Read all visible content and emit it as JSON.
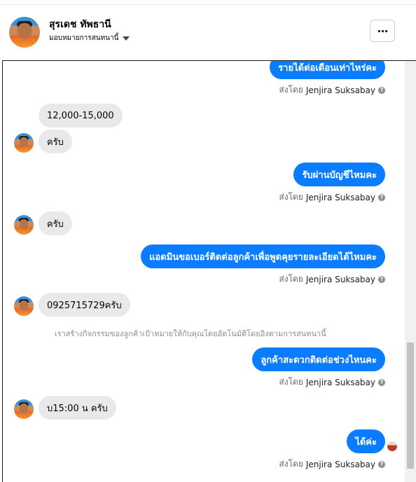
{
  "header": {
    "name": "สุรเดช ทัพธานี",
    "assign": "มอบหมายการสนทนานี้",
    "more_label": "···"
  },
  "icons": {
    "more": "more-horizontal-icon",
    "caret": "caret-down-icon",
    "help": "help-circle-icon"
  },
  "messages": [
    {
      "dir": "out",
      "text": "รายได้ต่อเดือนเท่าไหร่คะ"
    },
    {
      "dir": "meta",
      "prefix": "ส่งโดย",
      "who": "Jenjira Suksabay"
    },
    {
      "dir": "in",
      "text": "12,000-15,000"
    },
    {
      "dir": "in",
      "text": "ครับ"
    },
    {
      "dir": "out",
      "text": "รับผ่านบัญชีไหมคะ"
    },
    {
      "dir": "meta",
      "prefix": "ส่งโดย",
      "who": "Jenjira Suksabay"
    },
    {
      "dir": "in",
      "text": "ครับ"
    },
    {
      "dir": "out",
      "text": "แอดมินขอเบอร์ติดต่อลูกค้าเพื่อพูดคุยรายละเอียดได้ไหมคะ"
    },
    {
      "dir": "meta",
      "prefix": "ส่งโดย",
      "who": "Jenjira Suksabay"
    },
    {
      "dir": "in",
      "text": "0925715729ครับ"
    },
    {
      "dir": "system",
      "text": "เราสร้างกิจกรรมของลูกค้าเป้าหมายให้กับคุณโดยอัตโนมัติโดยอิงตามการสนทนานี้"
    },
    {
      "dir": "out",
      "text": "ลูกค้าสะดวกติดต่อช่วงไหนคะ"
    },
    {
      "dir": "meta",
      "prefix": "ส่งโดย",
      "who": "Jenjira Suksabay"
    },
    {
      "dir": "in",
      "text": "บ15:00 น  ครับ"
    },
    {
      "dir": "out",
      "text": "ได้ค่ะ"
    },
    {
      "dir": "meta",
      "prefix": "ส่งโดย",
      "who": "Jenjira Suksabay"
    }
  ]
}
